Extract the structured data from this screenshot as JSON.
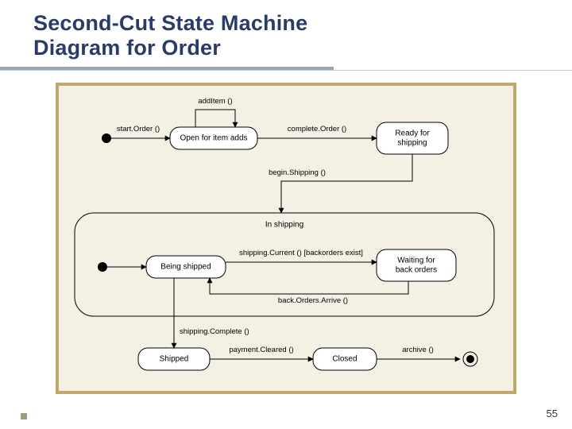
{
  "title_line1": "Second-Cut State Machine",
  "title_line2": "Diagram for Order",
  "page_number": "55",
  "states": {
    "open": "Open for item adds",
    "ready": "Ready for\nshipping",
    "in_shipping": "In shipping",
    "being_shipped": "Being shipped",
    "waiting": "Waiting for\nback orders",
    "shipped": "Shipped",
    "closed": "Closed"
  },
  "transitions": {
    "start_order": "start.Order ()",
    "add_item": "addItem ()",
    "complete_order": "complete.Order ()",
    "begin_shipping": "begin.Shipping ()",
    "shipping_current": "shipping.Current () [backorders exist]",
    "back_orders_arrive": "back.Orders.Arrive ()",
    "shipping_complete": "shipping.Complete ()",
    "payment_cleared": "payment.Cleared ()",
    "archive": "archive ()"
  }
}
